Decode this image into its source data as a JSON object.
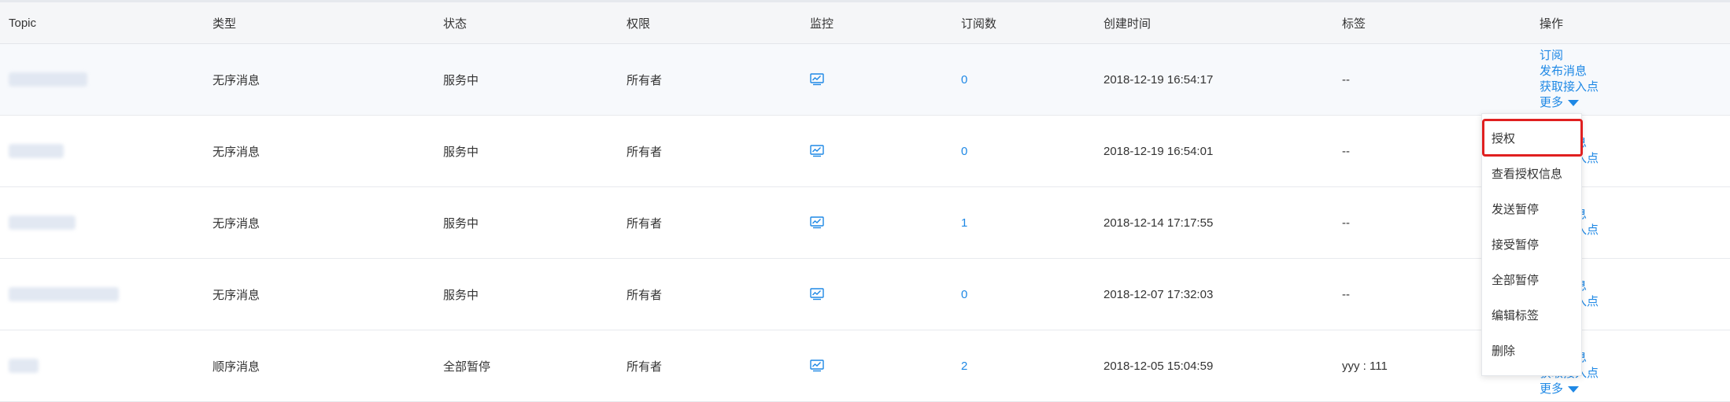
{
  "colors": {
    "header_bg": "#f5f6f8",
    "link": "#1e88e5",
    "highlight_border": "#e02020",
    "text": "#333333"
  },
  "header": {
    "topic": "Topic",
    "type": "类型",
    "status": "状态",
    "permission": "权限",
    "monitor": "监控",
    "subscriptions": "订阅数",
    "created": "创建时间",
    "tags": "标签",
    "actions": "操作"
  },
  "rows": [
    {
      "type": "无序消息",
      "status": "服务中",
      "permission": "所有者",
      "monitor_icon": "monitor-chart-icon",
      "subscriptions": "0",
      "created": "2018-12-19 16:54:17",
      "tags": "--"
    },
    {
      "type": "无序消息",
      "status": "服务中",
      "permission": "所有者",
      "monitor_icon": "monitor-chart-icon",
      "subscriptions": "0",
      "created": "2018-12-19 16:54:01",
      "tags": "--"
    },
    {
      "type": "无序消息",
      "status": "服务中",
      "permission": "所有者",
      "monitor_icon": "monitor-chart-icon",
      "subscriptions": "1",
      "created": "2018-12-14 17:17:55",
      "tags": "--"
    },
    {
      "type": "无序消息",
      "status": "服务中",
      "permission": "所有者",
      "monitor_icon": "monitor-chart-icon",
      "subscriptions": "0",
      "created": "2018-12-07 17:32:03",
      "tags": "--"
    },
    {
      "type": "顺序消息",
      "status": "全部暂停",
      "permission": "所有者",
      "monitor_icon": "monitor-chart-icon",
      "subscriptions": "2",
      "created": "2018-12-05 15:04:59",
      "tags": "yyy : 111"
    }
  ],
  "ops": {
    "subscribe": "订阅",
    "publish": "发布消息",
    "endpoint": "获取接入点",
    "more": "更多"
  },
  "dropdown": {
    "items": [
      "授权",
      "查看授权信息",
      "发送暂停",
      "接受暂停",
      "全部暂停",
      "编辑标签",
      "删除"
    ],
    "highlighted_index": 0
  }
}
